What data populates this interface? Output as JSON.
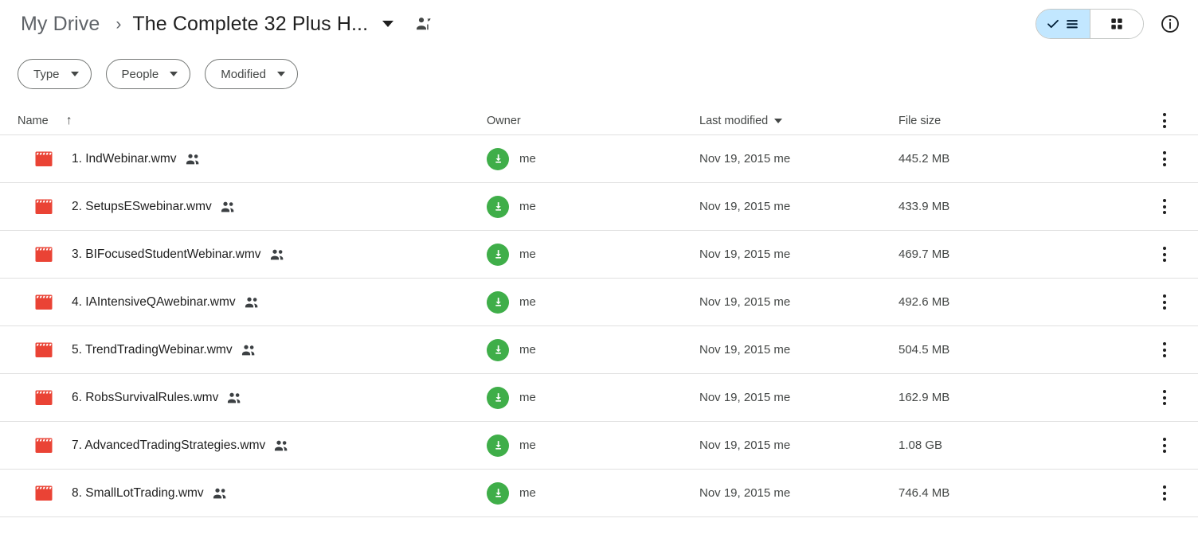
{
  "breadcrumb": {
    "root_label": "My Drive",
    "separator": "›",
    "current_label": "The Complete 32 Plus H...",
    "caret_icon": "chevron-down-icon",
    "share_icon": "person-shared-icon"
  },
  "topbar_actions": {
    "list_view_label": "List view",
    "grid_view_label": "Grid view",
    "info_label": "View details",
    "active_view": "list",
    "active_bg": "#c2e7ff"
  },
  "filters": [
    {
      "label": "Type"
    },
    {
      "label": "People"
    },
    {
      "label": "Modified"
    }
  ],
  "columns": {
    "name": "Name",
    "owner": "Owner",
    "last_modified": "Last modified",
    "file_size": "File size",
    "name_sort": "ascending",
    "name_sort_glyph": "↑",
    "modified_sort_glyph": "chevron-down-icon",
    "more_label": "More options"
  },
  "files": [
    {
      "name": "1. IndWebinar.wmv",
      "icon": "video-file-icon",
      "shared": true,
      "owner": "me",
      "modified": "Nov 19, 2015 me",
      "size": "445.2 MB"
    },
    {
      "name": "2. SetupsESwebinar.wmv",
      "icon": "video-file-icon",
      "shared": true,
      "owner": "me",
      "modified": "Nov 19, 2015 me",
      "size": "433.9 MB"
    },
    {
      "name": "3. BIFocusedStudentWebinar.wmv",
      "icon": "video-file-icon",
      "shared": true,
      "owner": "me",
      "modified": "Nov 19, 2015 me",
      "size": "469.7 MB"
    },
    {
      "name": "4. IAIntensiveQAwebinar.wmv",
      "icon": "video-file-icon",
      "shared": true,
      "owner": "me",
      "modified": "Nov 19, 2015 me",
      "size": "492.6 MB"
    },
    {
      "name": "5. TrendTradingWebinar.wmv",
      "icon": "video-file-icon",
      "shared": true,
      "owner": "me",
      "modified": "Nov 19, 2015 me",
      "size": "504.5 MB"
    },
    {
      "name": "6. RobsSurvivalRules.wmv",
      "icon": "video-file-icon",
      "shared": true,
      "owner": "me",
      "modified": "Nov 19, 2015 me",
      "size": "162.9 MB"
    },
    {
      "name": "7. AdvancedTradingStrategies.wmv",
      "icon": "video-file-icon",
      "shared": true,
      "owner": "me",
      "modified": "Nov 19, 2015 me",
      "size": "1.08 GB"
    },
    {
      "name": "8. SmallLotTrading.wmv",
      "icon": "video-file-icon",
      "shared": true,
      "owner": "me",
      "modified": "Nov 19, 2015 me",
      "size": "746.4 MB"
    }
  ],
  "colors": {
    "video_icon": "#ea4335",
    "owner_avatar": "#3fae49",
    "selected_chip": "#c2e7ff",
    "divider": "#e0e0e0"
  }
}
